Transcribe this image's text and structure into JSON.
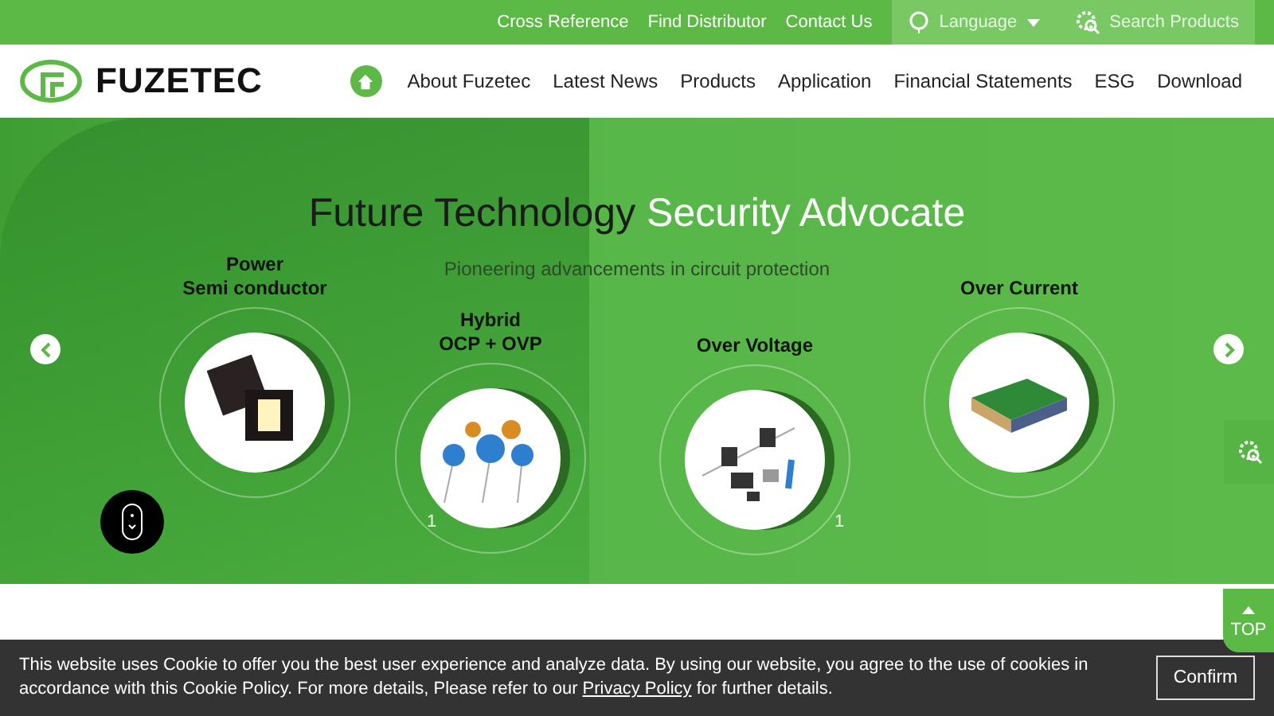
{
  "top_bar": {
    "links": [
      "Cross Reference",
      "Find Distributor",
      "Contact Us"
    ],
    "language": "Language",
    "search": "Search Products"
  },
  "header": {
    "logo": "FUZETEC",
    "nav": [
      "About Fuzetec",
      "Latest News",
      "Products",
      "Application",
      "Financial Statements",
      "ESG",
      "Download"
    ]
  },
  "hero": {
    "title_dark": "Future Technology",
    "title_light": "Security Advocate",
    "subtitle": "Pioneering advancements in circuit protection",
    "products": [
      {
        "kind": "chip",
        "label": [
          "Power",
          "Semi conductor"
        ]
      },
      {
        "kind": "varistor",
        "label": [
          "Hybrid",
          "OCP + OVP"
        ],
        "index": "1"
      },
      {
        "kind": "diode",
        "label": [
          "Over Voltage"
        ],
        "index": "1"
      },
      {
        "kind": "fuse",
        "label": [
          "Over Current"
        ]
      }
    ]
  },
  "side": {
    "top": "TOP"
  },
  "cookie": {
    "text": "This website uses Cookie to offer you the best user experience and analyze data. By using our website, you agree to the use of cookies in accordance with this Cookie Policy. For more details, Please refer to our",
    "link": "Privacy Policy",
    "text_end": "for further details.",
    "button": "Confirm"
  }
}
